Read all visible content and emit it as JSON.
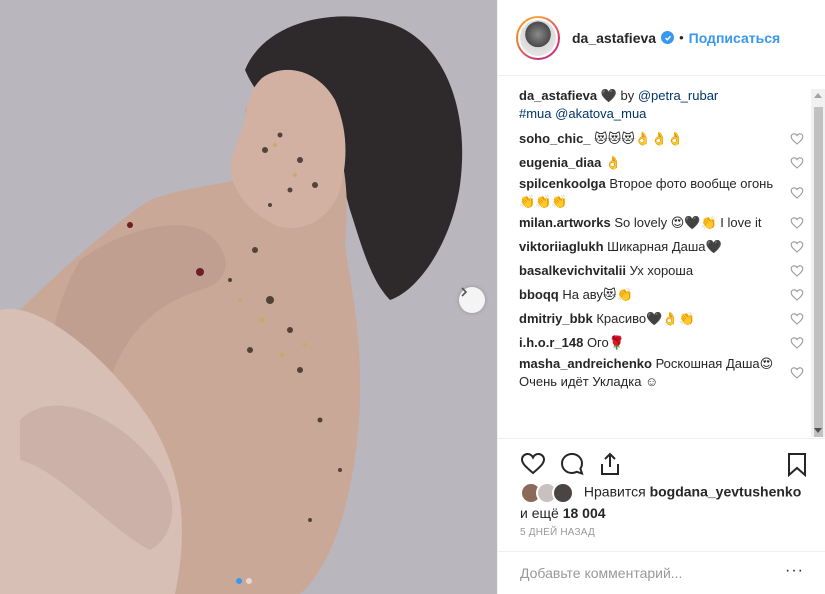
{
  "post": {
    "image_alt": "Photo by da_astafieva",
    "carousel": {
      "total": 2,
      "current": 1
    }
  },
  "header": {
    "username": "da_astafieva",
    "separator": "•",
    "follow_label": "Подписаться"
  },
  "caption": {
    "username": "da_astafieva",
    "text": "🖤 by",
    "mention1": "@petra_rubar",
    "hashtag": "#mua",
    "mention2": "@akatova_mua"
  },
  "comments": [
    {
      "user": "soho_chic_",
      "text": "😻😻😻👌👌👌"
    },
    {
      "user": "eugenia_diaa",
      "text": "👌"
    },
    {
      "user": "spilcenkoolga",
      "text": "Второе фото вообще огонь👏👏👏"
    },
    {
      "user": "milan.artworks",
      "text": "So lovely 😍🖤👏 I love it"
    },
    {
      "user": "viktoriiaglukh",
      "text": "Шикарная Даша🖤"
    },
    {
      "user": "basalkevichvitalii",
      "text": "Ух хороша"
    },
    {
      "user": "bboqq",
      "text": "На аву😻👏"
    },
    {
      "user": "dmitriy_bbk",
      "text": "Красиво🖤👌👏"
    },
    {
      "user": "i.h.o.r_148",
      "text": "Ого🌹"
    },
    {
      "user": "masha_andreichenko",
      "text": "Роскошная Даша😍 Очень идёт Укладка ☺"
    }
  ],
  "likes": {
    "prefix": "Нравится",
    "user": "bogdana_yevtushenko",
    "middle": "и ещё",
    "count": "18 004"
  },
  "timestamp": "5 дней назад",
  "comment_input": {
    "placeholder": "Добавьте комментарий...",
    "value": ""
  },
  "more_label": "···",
  "colors": {
    "accent": "#3897f0",
    "text": "#262626",
    "muted": "#999999",
    "link": "#003569"
  }
}
